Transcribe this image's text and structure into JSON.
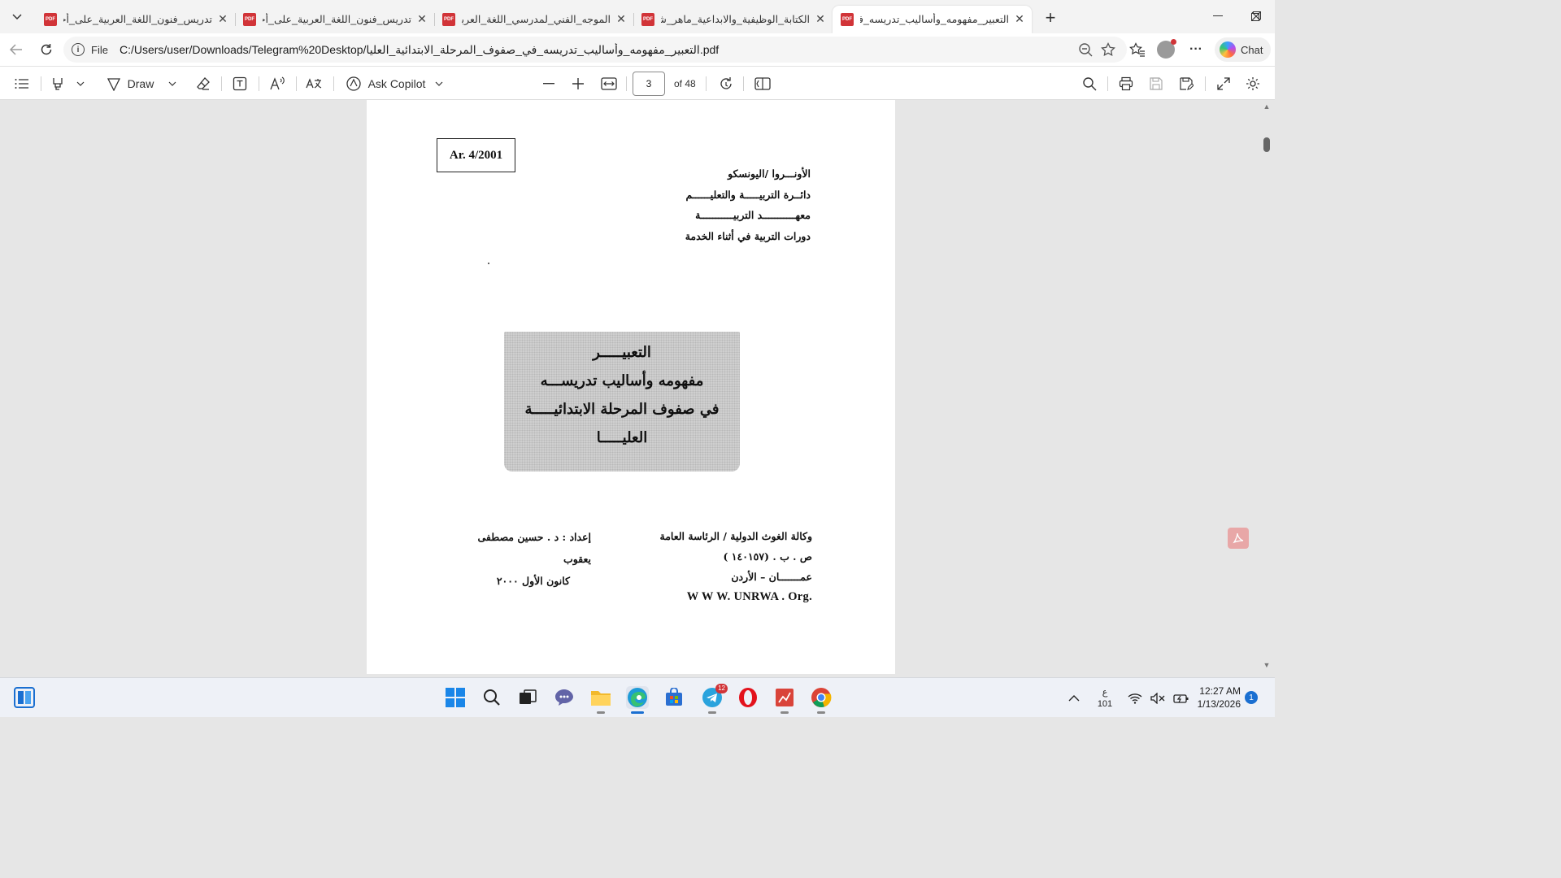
{
  "browser": {
    "tabs": [
      {
        "title": "تدريس_فنون_اللغة_العربية_على_أحمد",
        "active": false
      },
      {
        "title": "تدريس_فنون_اللغة_العربية_على_أحمد",
        "active": false
      },
      {
        "title": "الموجه_الفني_لمدرسي_اللغة_العربية_ة",
        "active": false
      },
      {
        "title": "الكتابة_الوظيفية_والابداعية_ماهر_شعبان",
        "active": false
      },
      {
        "title": "التعبير_مفهومه_وأساليب_تدريسه_في",
        "active": true
      }
    ],
    "address": {
      "scheme": "File",
      "url": "C:/Users/user/Downloads/Telegram%20Desktop/التعبير_مفهومه_وأساليب_تدريسه_في_صفوف_المرحلة_الابتدائية_العليا.pdf"
    },
    "chat_label": "Chat"
  },
  "pdf_toolbar": {
    "draw_label": "Draw",
    "copilot_label": "Ask Copilot",
    "page_number": "3",
    "page_count": "of 48"
  },
  "document": {
    "ref_code": "Ar. 4/2001",
    "org_lines": [
      "الأونـــروا /اليونسكو",
      "دائــرة التربيـــــة والتعليــــــم",
      "معهـــــــــــد التربيـــــــــــة",
      "دورات التربية في أثناء الخدمة"
    ],
    "title_lines": [
      "التعبيـــــر",
      "مفهومه وأساليب تدريســـه",
      "في صفوف المرحلة الابتدائيـــــة",
      "العليـــــا"
    ],
    "agency_lines": [
      "وكالة الغوث الدولية / الرئاسة العامة",
      "ص . ب . (١٤٠١٥٧ )",
      "عمـــــــان  –  الأردن"
    ],
    "website": "W W W. UNRWA . Org.",
    "author": "إعداد : د . حسين مصطفى يعقوب",
    "date": "كانون الأول ٢٠٠٠"
  },
  "taskbar": {
    "telegram_badge": "12",
    "keyboard_lang": "ع",
    "keyboard_code": "101",
    "time": "12:27 AM",
    "date": "1/13/2026",
    "notification_count": "1"
  },
  "colors": {
    "accent": "#1a6fd1",
    "pdf_red": "#d13438"
  }
}
